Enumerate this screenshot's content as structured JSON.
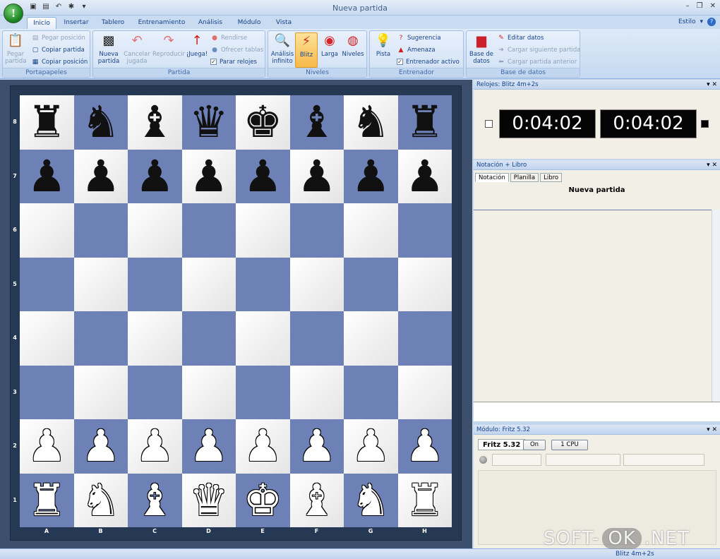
{
  "window": {
    "title": "Nueva partida",
    "app_logo_letter": "!",
    "style_label": "Estilo"
  },
  "tabs": [
    "Inicio",
    "Insertar",
    "Tablero",
    "Entrenamiento",
    "Análisis",
    "Módulo",
    "Vista"
  ],
  "ribbon": {
    "portapapeles": {
      "label": "Portapapeles",
      "pegar_partida": "Pegar partida",
      "pegar_posicion": "Pegar posición",
      "copiar_partida": "Copiar partida",
      "copiar_posicion": "Copiar posición"
    },
    "partida": {
      "label": "Partida",
      "nueva_partida": "Nueva partida",
      "cancelar_jugada": "Cancelar jugada",
      "reproducir": "Reproducir",
      "juega": "¡Juega!",
      "rendirse": "Rendirse",
      "ofrecer_tablas": "Ofrecer tablas",
      "parar_relojes": "Parar relojes"
    },
    "niveles": {
      "label": "Niveles",
      "analisis_infinito": "Análisis infinito",
      "blitz": "Blitz",
      "larga": "Larga",
      "niveles": "Niveles"
    },
    "entrenador": {
      "label": "Entrenador",
      "pista": "Pista",
      "sugerencia": "Sugerencia",
      "amenaza": "Amenaza",
      "entrenador_activo": "Entrenador activo"
    },
    "base_datos": {
      "label": "Base de datos",
      "base_datos_btn": "Base de datos",
      "editar_datos": "Editar datos",
      "cargar_siguiente": "Cargar siguiente partida",
      "cargar_anterior": "Cargar partida anterior"
    }
  },
  "board": {
    "ranks": [
      "8",
      "7",
      "6",
      "5",
      "4",
      "3",
      "2",
      "1"
    ],
    "files": [
      "A",
      "B",
      "C",
      "D",
      "E",
      "F",
      "G",
      "H"
    ],
    "position": [
      [
        "br",
        "bn",
        "bb",
        "bq",
        "bk",
        "bb",
        "bn",
        "br"
      ],
      [
        "bp",
        "bp",
        "bp",
        "bp",
        "bp",
        "bp",
        "bp",
        "bp"
      ],
      [
        "",
        "",
        "",
        "",
        "",
        "",
        "",
        ""
      ],
      [
        "",
        "",
        "",
        "",
        "",
        "",
        "",
        ""
      ],
      [
        "",
        "",
        "",
        "",
        "",
        "",
        "",
        ""
      ],
      [
        "",
        "",
        "",
        "",
        "",
        "",
        "",
        ""
      ],
      [
        "wp",
        "wp",
        "wp",
        "wp",
        "wp",
        "wp",
        "wp",
        "wp"
      ],
      [
        "wr",
        "wn",
        "wb",
        "wq",
        "wk",
        "wb",
        "wn",
        "wr"
      ]
    ],
    "colors": {
      "light": "#ffffff",
      "dark": "#6e81b6"
    }
  },
  "clocks": {
    "header": "Relojes: Blitz 4m+2s",
    "white_time": "0:04:02",
    "black_time": "0:04:02"
  },
  "notation": {
    "header": "Notación + Libro",
    "tabs": [
      "Notación",
      "Planilla",
      "Libro"
    ],
    "title": "Nueva partida"
  },
  "engine": {
    "header": "Módulo: Fritz 5.32",
    "name": "Fritz 5.32",
    "on_label": "On",
    "cpu_label": "1 CPU"
  },
  "status": {
    "text": "Blitz 4m+2s"
  },
  "watermark": {
    "left": "SOFT-",
    "ok": "OK",
    "right": ".NET"
  }
}
